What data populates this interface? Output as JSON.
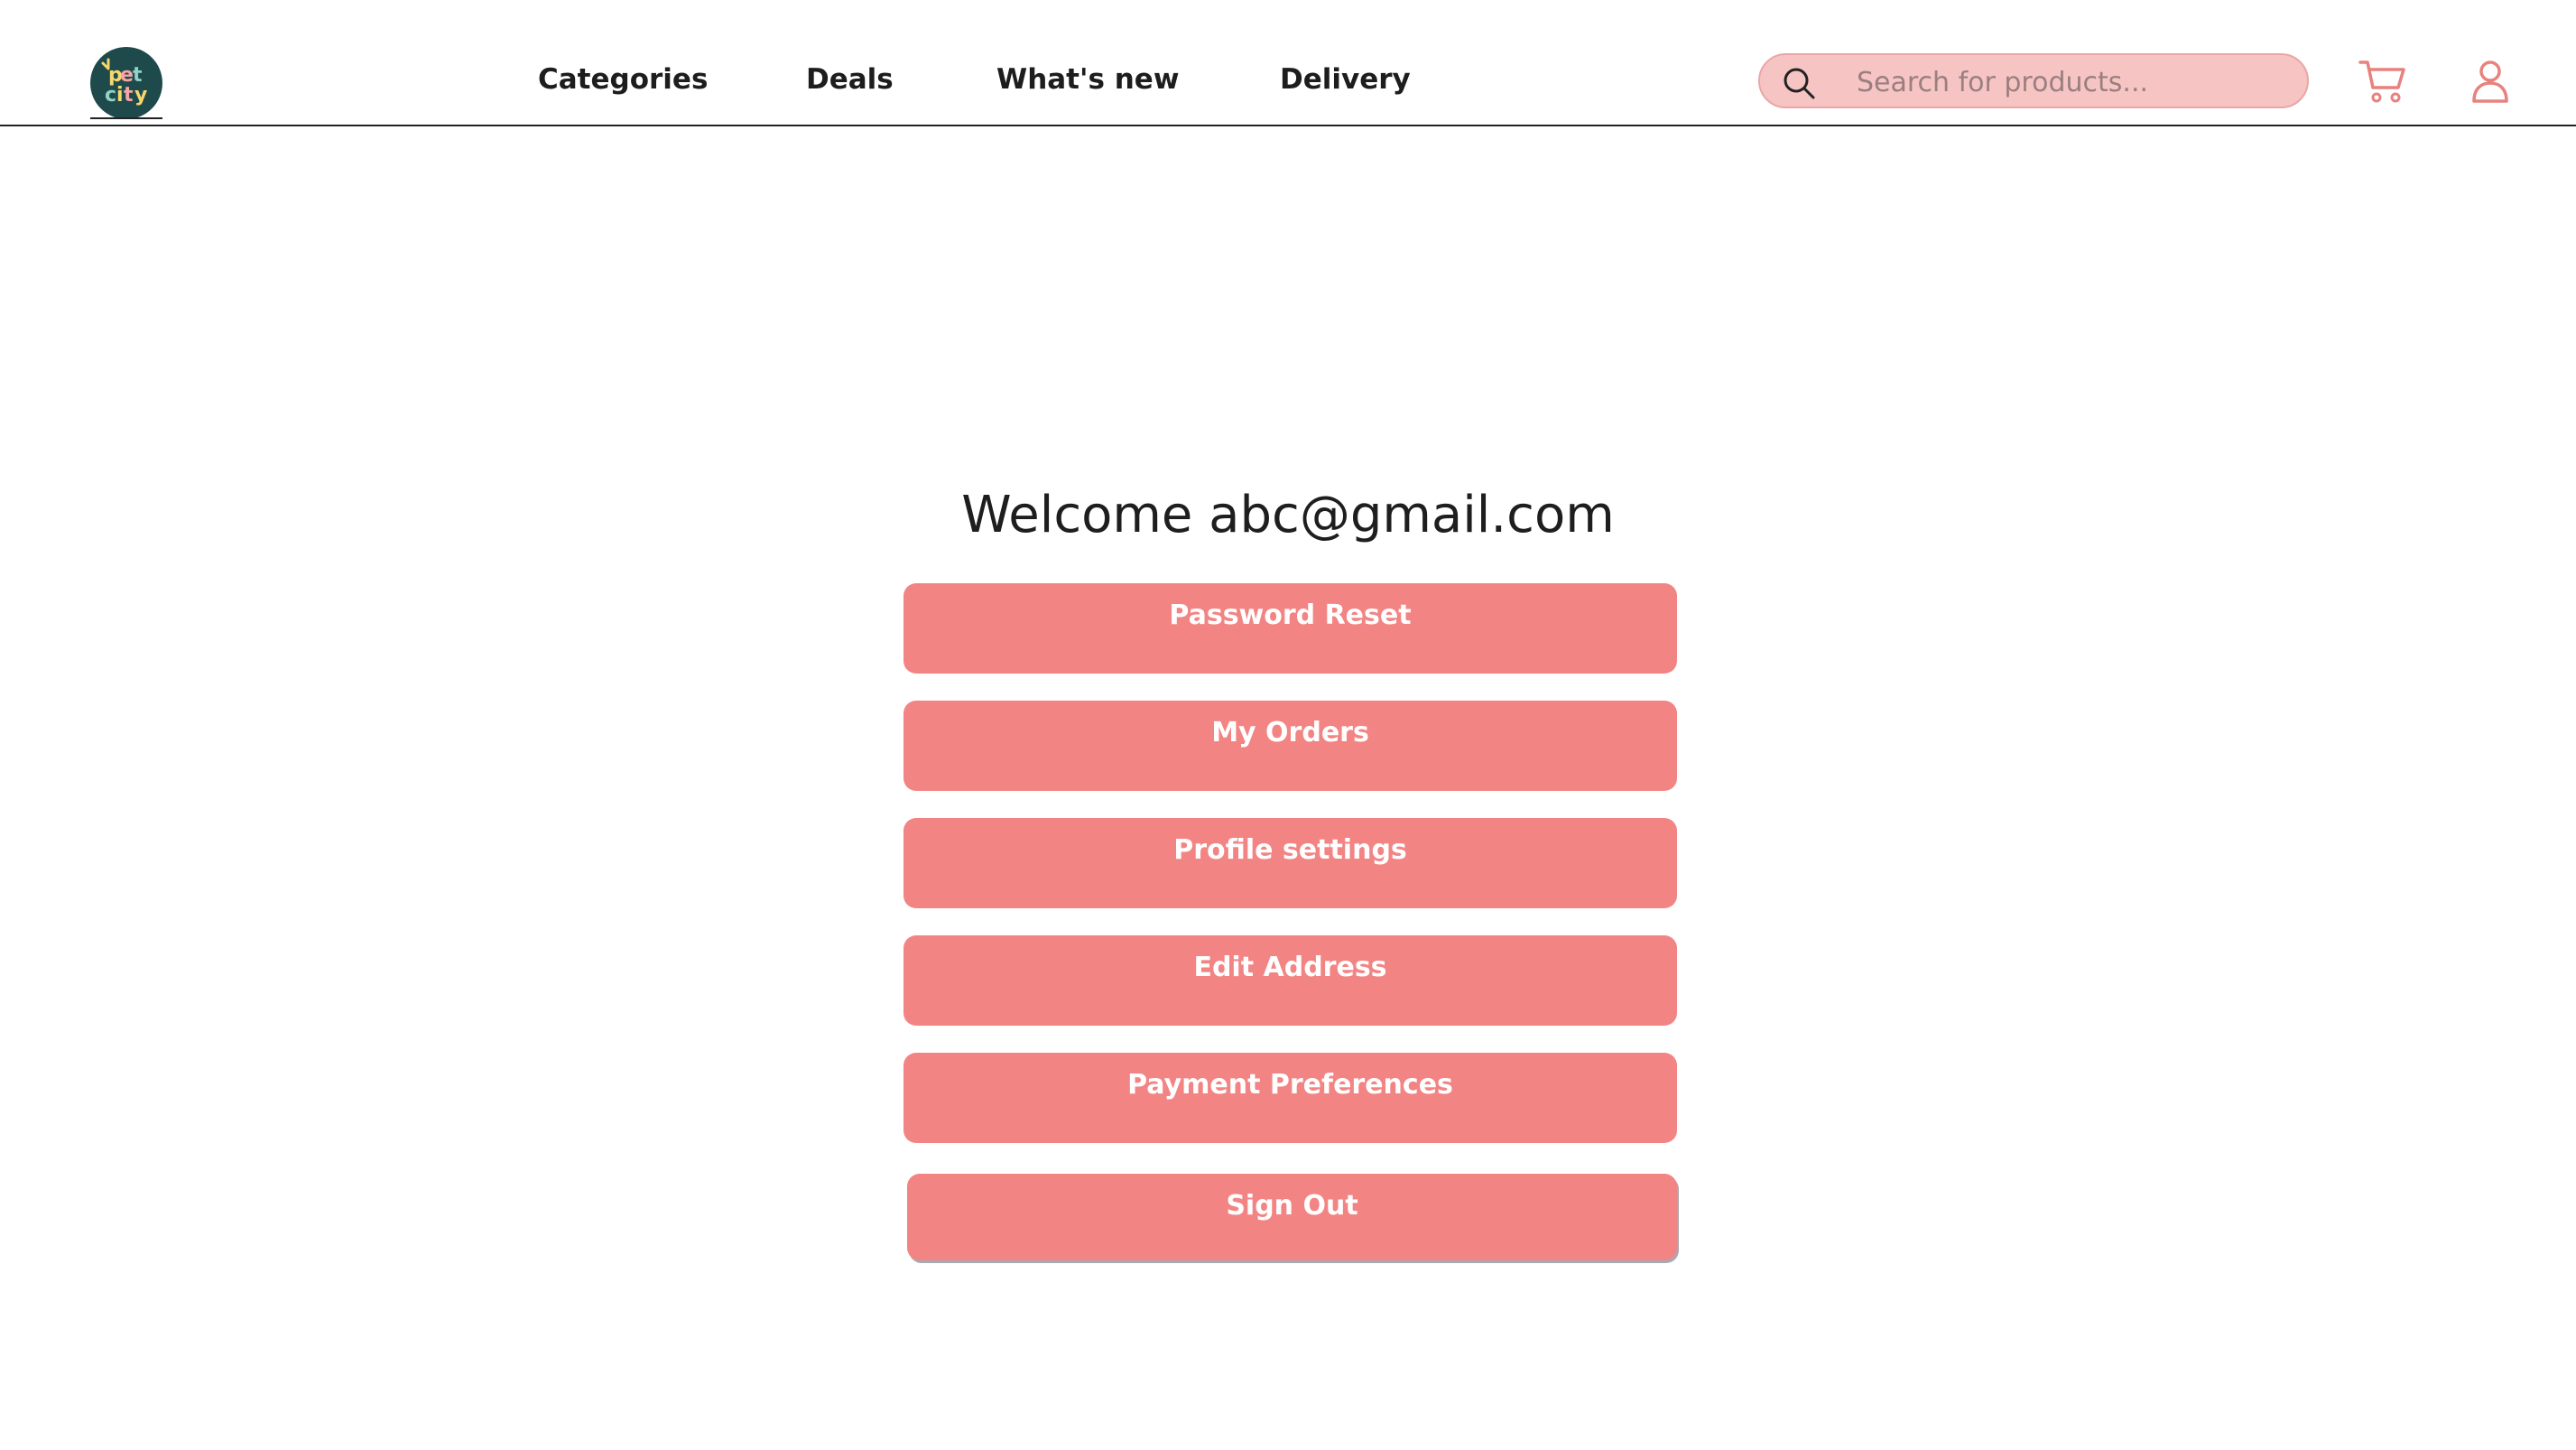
{
  "header": {
    "logo_alt": "pet city",
    "nav": [
      "Categories",
      "Deals",
      "What's new",
      "Delivery"
    ],
    "search": {
      "placeholder": "Search for products..."
    },
    "icons": {
      "search": "search-icon",
      "cart": "cart-icon",
      "account": "user-icon"
    }
  },
  "main": {
    "welcome": "Welcome abc@gmail.com",
    "buttons": [
      "Password Reset",
      "My Orders",
      "Profile settings",
      "Edit Address",
      "Payment Preferences",
      "Sign Out"
    ]
  },
  "colors": {
    "accent": "#f38484",
    "search_bg": "#f7c4c4",
    "logo_bg": "#1f4a4c",
    "icon": "#e8827f"
  }
}
